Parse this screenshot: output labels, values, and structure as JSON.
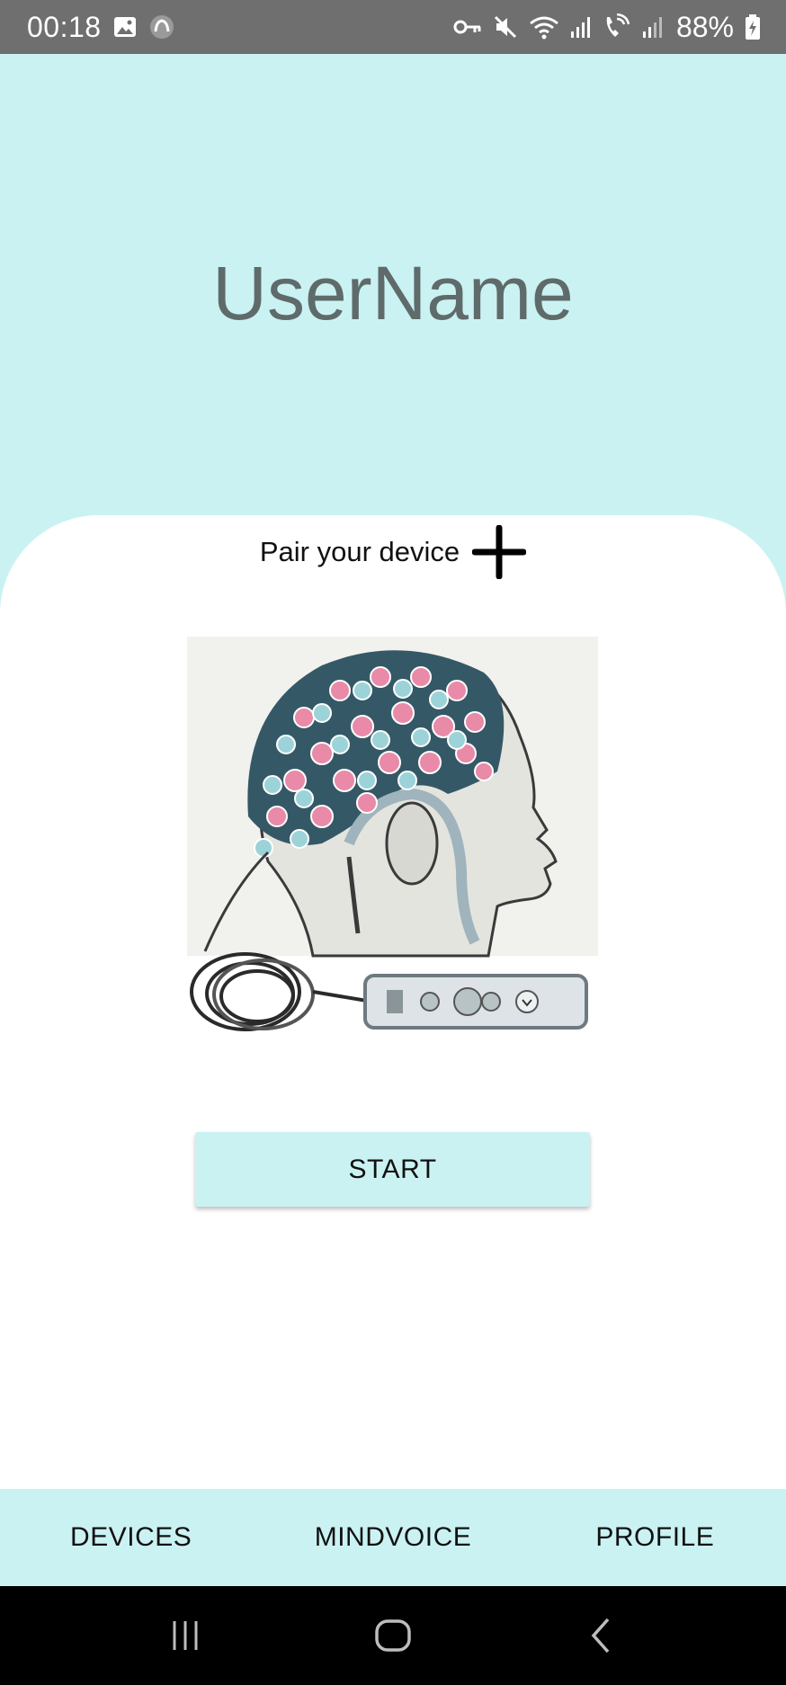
{
  "status_bar": {
    "time": "00:18",
    "battery": "88%",
    "icons": [
      "gallery-icon",
      "sync-icon",
      "vpn-key-icon",
      "mute-icon",
      "wifi-icon",
      "signal-icon",
      "wifi-call-icon",
      "signal-2-icon",
      "battery-charging-icon"
    ]
  },
  "header": {
    "username": "UserName"
  },
  "pair": {
    "label": "Pair your device",
    "icon": "plus-icon"
  },
  "illustration": {
    "icon": "eeg-headset-illustration"
  },
  "start_button": {
    "label": "START"
  },
  "bottom_nav": {
    "tabs": [
      {
        "label": "DEVICES"
      },
      {
        "label": "MINDVOICE"
      },
      {
        "label": "PROFILE"
      }
    ]
  },
  "system_nav": {
    "icons": [
      "recents-icon",
      "home-icon",
      "back-icon"
    ]
  },
  "colors": {
    "accent": "#cbf2f3",
    "status_bar": "#6f6f6f",
    "username_text": "#5f6b6b",
    "nav_bar": "#000000"
  }
}
